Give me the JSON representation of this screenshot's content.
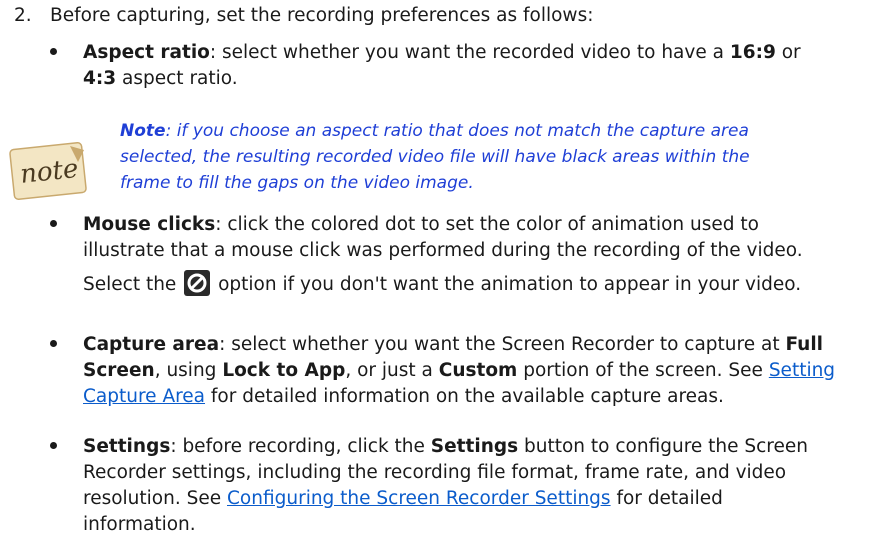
{
  "step": {
    "number": "2.",
    "text": "Before capturing, set the recording preferences as follows:"
  },
  "bullets": {
    "aspect": {
      "term": "Aspect ratio",
      "l1a": ": select whether you want the recorded video to have a ",
      "b1": "16:9",
      "l1b": " or",
      "b2": "4:3",
      "l2": " aspect ratio."
    },
    "note": {
      "icon": "note-sticker-icon",
      "label": "Note",
      "l1": ": if you choose an aspect ratio that does not match the capture area",
      "l2": "selected, the resulting recorded video file will have black areas within the",
      "l3": "frame to fill the gaps on the video image."
    },
    "mouse": {
      "term": "Mouse clicks",
      "l1": ": click the colored dot to set the color of animation used to",
      "l2": "illustrate that a mouse click was performed during the recording of the video.",
      "l3a": "Select the ",
      "icon": "no-symbol-icon",
      "l3b": " option if you don't want the animation to appear in your video."
    },
    "capture": {
      "term": "Capture area",
      "l1a": ": select whether you want the Screen Recorder to capture at ",
      "b1": "Full",
      "b2": "Screen",
      "l2a": ", using ",
      "b3": "Lock to App",
      "l2b": ", or just a ",
      "b4": "Custom",
      "l2c": " portion of the screen. See ",
      "link1": "Setting",
      "link2": "Capture Area",
      "l3": " for detailed information on the available capture areas."
    },
    "settings": {
      "term": "Settings",
      "l1a": ": before recording, click the ",
      "b1": "Settings",
      "l1b": " button to configure the Screen",
      "l2": "Recorder settings, including the recording file format, frame rate, and video",
      "l3a": "resolution. See ",
      "link": "Configuring the Screen Recorder Settings",
      "l3b": " for detailed",
      "l4": "information."
    }
  }
}
